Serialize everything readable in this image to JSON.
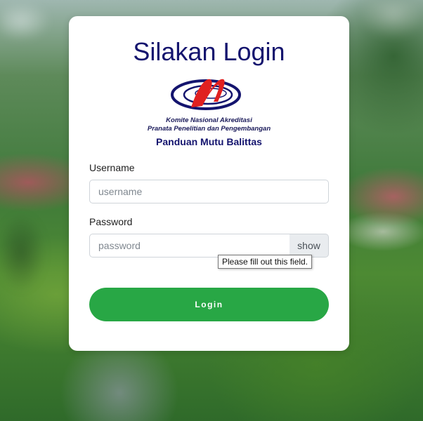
{
  "page": {
    "title": "Silakan Login"
  },
  "logo": {
    "icon": "kna-logo-icon",
    "line1": "Komite Nasional Akreditasi",
    "line2": "Pranata Penelitian dan Pengembangan"
  },
  "subtitle": "Panduan Mutu Balittas",
  "form": {
    "username_label": "Username",
    "username_placeholder": "username",
    "password_label": "Password",
    "password_placeholder": "password",
    "show_label": "show",
    "validation_tooltip": "Please fill out this field.",
    "login_label": "Login"
  },
  "colors": {
    "title": "#14146e",
    "login_button": "#28a745",
    "logo_red": "#e02020",
    "logo_navy": "#14146e"
  }
}
